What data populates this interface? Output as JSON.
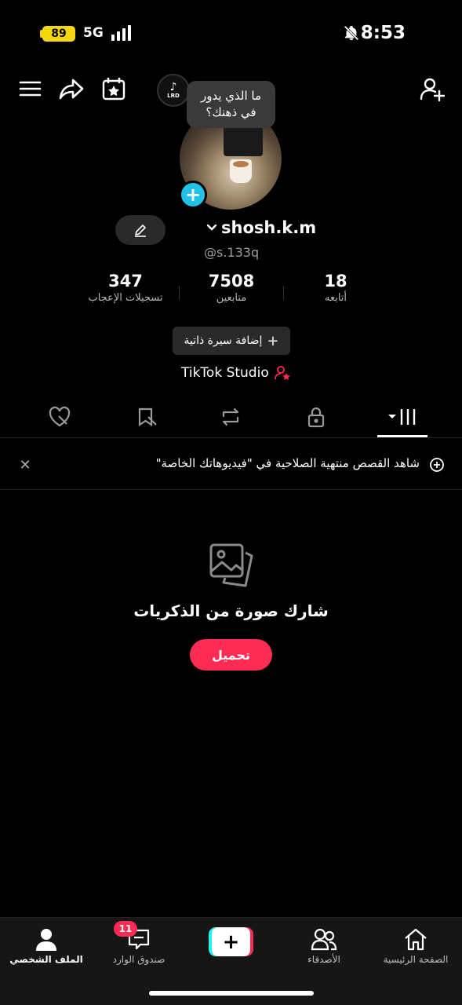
{
  "status": {
    "battery": "89",
    "network": "5G",
    "time": "8:53",
    "icons": [
      "signal-icon",
      "bell-off-icon"
    ]
  },
  "top_bar": {
    "icons": [
      "menu-icon",
      "share-icon",
      "calendar-star-icon",
      "add-friend-icon"
    ]
  },
  "profile": {
    "lrd_badge": "LRD",
    "thought_bubble": "ما الذي يدور في ذهنك؟",
    "username": "shosh.k.m",
    "handle": "@s.133q",
    "stats": [
      {
        "num": "347",
        "label": "تسجيلات الإعجاب"
      },
      {
        "num": "7508",
        "label": "متابعين"
      },
      {
        "num": "18",
        "label": "أتابعه"
      }
    ],
    "bio_button": "إضافة سيرة ذاتية",
    "studio_link": "TikTok Studio"
  },
  "tabs": {
    "items": [
      "liked-icon",
      "favorites-hidden-icon",
      "repost-icon",
      "lock-icon",
      "grid-icon"
    ],
    "active": "grid-icon"
  },
  "notice": {
    "text": "شاهد القصص منتهية الصلاحية في \"فيديوهاتك الخاصة\""
  },
  "empty_state": {
    "title": "شارك صورة من الذكريات",
    "button": "تحميل"
  },
  "bottom_nav": {
    "items": [
      {
        "label": "الملف الشخصي",
        "icon": "profile-icon",
        "active": true
      },
      {
        "label": "صندوق الوارد",
        "icon": "inbox-icon",
        "badge": "11"
      },
      {
        "label": "",
        "icon": "create-icon"
      },
      {
        "label": "الأصدقاء",
        "icon": "friends-icon"
      },
      {
        "label": "الصفحة الرئيسية",
        "icon": "home-icon"
      }
    ]
  },
  "colors": {
    "accent": "#fe2c55",
    "cyan": "#25f4ee",
    "battery": "#f5d70f",
    "avatar_plus": "#21c1e8"
  }
}
